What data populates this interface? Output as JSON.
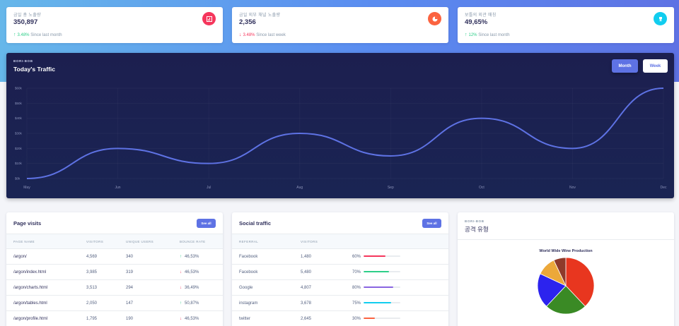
{
  "stats": [
    {
      "title": "금일 총 노출량",
      "value": "350,897",
      "change": "3.48%",
      "direction": "up",
      "period": "Since last month",
      "icon": "chart-bar-icon",
      "icon_color": "#f5365c"
    },
    {
      "title": "금일 외부 채널 노출량",
      "value": "2,356",
      "change": "3.48%",
      "direction": "down",
      "period": "Since last week",
      "icon": "chart-pie-icon",
      "icon_color": "#fb6340"
    },
    {
      "title": "보틀의 외관 매칭",
      "value": "49,65%",
      "change": "12%",
      "direction": "up",
      "period": "Since last month",
      "icon": "trophy-icon",
      "icon_color": "#11cdef"
    }
  ],
  "traffic": {
    "overline": "BORI-BOB",
    "title": "Today's Traffic",
    "month_label": "Month",
    "week_label": "Week"
  },
  "chart_data": {
    "type": "line",
    "categories": [
      "May",
      "Jun",
      "Jul",
      "Aug",
      "Sep",
      "Oct",
      "Nov",
      "Dec"
    ],
    "values": [
      0,
      20,
      10,
      30,
      15,
      40,
      20,
      60
    ],
    "y_ticks": [
      "$0k",
      "$10k",
      "$20k",
      "$30k",
      "$40k",
      "$50k",
      "$60k"
    ],
    "ylim": [
      0,
      60
    ],
    "color": "#5e72e4"
  },
  "page_visits": {
    "title": "Page visits",
    "see_all": "See all",
    "headers": [
      "PAGE NAME",
      "VISITORS",
      "UNIQUE USERS",
      "BOUNCE RATE"
    ],
    "rows": [
      {
        "name": "/argon/",
        "visitors": "4,569",
        "unique": "340",
        "bounce": "46,53%",
        "direction": "up"
      },
      {
        "name": "/argon/index.html",
        "visitors": "3,985",
        "unique": "319",
        "bounce": "46,53%",
        "direction": "down"
      },
      {
        "name": "/argon/charts.html",
        "visitors": "3,513",
        "unique": "294",
        "bounce": "36,49%",
        "direction": "down"
      },
      {
        "name": "/argon/tables.html",
        "visitors": "2,050",
        "unique": "147",
        "bounce": "50,87%",
        "direction": "up"
      },
      {
        "name": "/argon/profile.html",
        "visitors": "1,795",
        "unique": "190",
        "bounce": "46,53%",
        "direction": "down"
      }
    ]
  },
  "social_traffic": {
    "title": "Social traffic",
    "see_all": "See all",
    "headers": [
      "REFERRAL",
      "VISITORS",
      ""
    ],
    "rows": [
      {
        "name": "Facebook",
        "visitors": "1,480",
        "percent": "60%",
        "fill": 0.6,
        "color": "#f5365c"
      },
      {
        "name": "Facebook",
        "visitors": "5,480",
        "percent": "70%",
        "fill": 0.7,
        "color": "#2dce89"
      },
      {
        "name": "Google",
        "visitors": "4,807",
        "percent": "80%",
        "fill": 0.8,
        "color": "#8965e0"
      },
      {
        "name": "instagram",
        "visitors": "3,678",
        "percent": "75%",
        "fill": 0.75,
        "color": "#11cdef"
      },
      {
        "name": "twitter",
        "visitors": "2,645",
        "percent": "30%",
        "fill": 0.3,
        "color": "#fb6340"
      }
    ]
  },
  "pie": {
    "overline": "BORI-BOB",
    "title": "공격 유형",
    "chart_title": "World Wide Wine Production"
  },
  "pie_chart_data": {
    "type": "pie",
    "values": [
      38,
      24,
      20,
      11,
      7
    ],
    "colors": [
      "#e8361f",
      "#3a8a25",
      "#2c23ee",
      "#eca83a",
      "#8e3a2a"
    ]
  }
}
